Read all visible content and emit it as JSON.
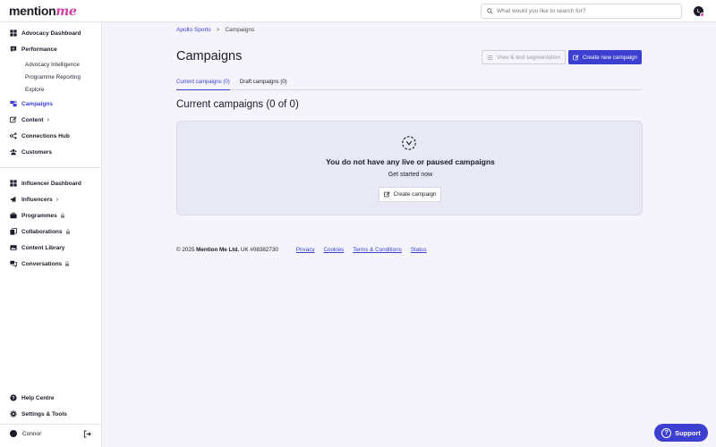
{
  "header": {
    "logo_main": "mention",
    "logo_accent": "me",
    "search_placeholder": "What would you like to search for?",
    "avatar_initial": "L"
  },
  "sidebar": {
    "items": [
      {
        "label": "Advocacy Dashboard"
      },
      {
        "label": "Performance"
      },
      {
        "label": "Campaigns"
      },
      {
        "label": "Content"
      },
      {
        "label": "Connections Hub"
      },
      {
        "label": "Customers"
      },
      {
        "label": "Influencer Dashboard"
      },
      {
        "label": "Influencers"
      },
      {
        "label": "Programmes"
      },
      {
        "label": "Collaborations"
      },
      {
        "label": "Content Library"
      },
      {
        "label": "Conversations"
      },
      {
        "label": "Help Centre"
      },
      {
        "label": "Settings & Tools"
      }
    ],
    "sub_items": [
      {
        "label": "Advocacy Intelligence"
      },
      {
        "label": "Programme Reporting"
      },
      {
        "label": "Explore"
      }
    ],
    "user_name": "Connor"
  },
  "breadcrumb": {
    "parent": "Apollo Sports",
    "separator": ">",
    "current": "Campaigns"
  },
  "page": {
    "title": "Campaigns",
    "view_segmentation_label": "View & test segmentation",
    "create_new_label": "Create new campaign"
  },
  "tabs": [
    {
      "label": "Current campaigns (0)",
      "active": true
    },
    {
      "label": "Draft campaigns (0)",
      "active": false
    }
  ],
  "section": {
    "title": "Current campaigns (0 of 0)"
  },
  "empty_state": {
    "title": "You do not have any live or paused campaigns",
    "subtitle": "Get started now",
    "button_label": "Create campaign"
  },
  "footer": {
    "copyright": "© 2025",
    "company": "Mention Me Ltd.",
    "reg": "UK #08382730",
    "links": [
      "Privacy",
      "Cookies",
      "Terms & Conditions",
      "Status"
    ]
  },
  "support": {
    "label": "Support"
  },
  "colors": {
    "accent": "#3d3fd0",
    "brand_pink": "#d43da0",
    "background": "#f4f4fa"
  }
}
